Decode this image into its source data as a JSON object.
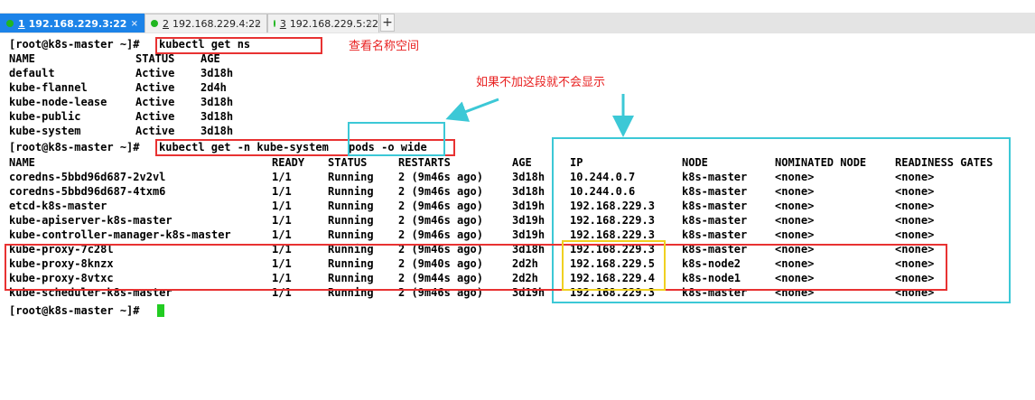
{
  "tabs": [
    {
      "num": "1",
      "title": "192.168.229.3:22",
      "active": true
    },
    {
      "num": "2",
      "title": "192.168.229.4:22",
      "active": false
    },
    {
      "num": "3",
      "title": "192.168.229.5:22",
      "active": false
    }
  ],
  "new_tab_label": "+",
  "close_glyph": "×",
  "prompt": "[root@k8s-master ~]#",
  "cmd1": "kubectl get ns",
  "ns_header": {
    "name": "NAME",
    "status": "STATUS",
    "age": "AGE"
  },
  "namespaces": [
    {
      "name": "default",
      "status": "Active",
      "age": "3d18h"
    },
    {
      "name": "kube-flannel",
      "status": "Active",
      "age": "2d4h"
    },
    {
      "name": "kube-node-lease",
      "status": "Active",
      "age": "3d18h"
    },
    {
      "name": "kube-public",
      "status": "Active",
      "age": "3d18h"
    },
    {
      "name": "kube-system",
      "status": "Active",
      "age": "3d18h"
    }
  ],
  "cmd2_part1": "kubectl get -n kube-system",
  "cmd2_part2": "pods -o wide",
  "pod_header": {
    "name": "NAME",
    "ready": "READY",
    "status": "STATUS",
    "restarts": "RESTARTS",
    "age": "AGE",
    "ip": "IP",
    "node": "NODE",
    "nominated": "NOMINATED NODE",
    "readiness": "READINESS GATES"
  },
  "pods": [
    {
      "name": "coredns-5bbd96d687-2v2vl",
      "ready": "1/1",
      "status": "Running",
      "restarts": "2 (9m46s ago)",
      "age": "3d18h",
      "ip": "10.244.0.7",
      "node": "k8s-master",
      "nominated": "<none>",
      "readiness": "<none>"
    },
    {
      "name": "coredns-5bbd96d687-4txm6",
      "ready": "1/1",
      "status": "Running",
      "restarts": "2 (9m46s ago)",
      "age": "3d18h",
      "ip": "10.244.0.6",
      "node": "k8s-master",
      "nominated": "<none>",
      "readiness": "<none>"
    },
    {
      "name": "etcd-k8s-master",
      "ready": "1/1",
      "status": "Running",
      "restarts": "2 (9m46s ago)",
      "age": "3d19h",
      "ip": "192.168.229.3",
      "node": "k8s-master",
      "nominated": "<none>",
      "readiness": "<none>"
    },
    {
      "name": "kube-apiserver-k8s-master",
      "ready": "1/1",
      "status": "Running",
      "restarts": "2 (9m46s ago)",
      "age": "3d19h",
      "ip": "192.168.229.3",
      "node": "k8s-master",
      "nominated": "<none>",
      "readiness": "<none>"
    },
    {
      "name": "kube-controller-manager-k8s-master",
      "ready": "1/1",
      "status": "Running",
      "restarts": "2 (9m46s ago)",
      "age": "3d19h",
      "ip": "192.168.229.3",
      "node": "k8s-master",
      "nominated": "<none>",
      "readiness": "<none>"
    },
    {
      "name": "kube-proxy-7c28l",
      "ready": "1/1",
      "status": "Running",
      "restarts": "2 (9m46s ago)",
      "age": "3d18h",
      "ip": "192.168.229.3",
      "node": "k8s-master",
      "nominated": "<none>",
      "readiness": "<none>"
    },
    {
      "name": "kube-proxy-8knzx",
      "ready": "1/1",
      "status": "Running",
      "restarts": "2 (9m40s ago)",
      "age": "2d2h",
      "ip": "192.168.229.5",
      "node": "k8s-node2",
      "nominated": "<none>",
      "readiness": "<none>"
    },
    {
      "name": "kube-proxy-8vtxc",
      "ready": "1/1",
      "status": "Running",
      "restarts": "2 (9m44s ago)",
      "age": "2d2h",
      "ip": "192.168.229.4",
      "node": "k8s-node1",
      "nominated": "<none>",
      "readiness": "<none>"
    },
    {
      "name": "kube-scheduler-k8s-master",
      "ready": "1/1",
      "status": "Running",
      "restarts": "2 (9m46s ago)",
      "age": "3d19h",
      "ip": "192.168.229.3",
      "node": "k8s-master",
      "nominated": "<none>",
      "readiness": "<none>"
    }
  ],
  "annotations": {
    "view_ns": "查看名称空间",
    "no_show": "如果不加这段就不会显示"
  },
  "colors": {
    "tab_active": "#1c83e8",
    "highlight_red": "#e83232",
    "highlight_cyan": "#3cc8d6",
    "highlight_yellow": "#f0d020",
    "cursor": "#22cc22"
  }
}
